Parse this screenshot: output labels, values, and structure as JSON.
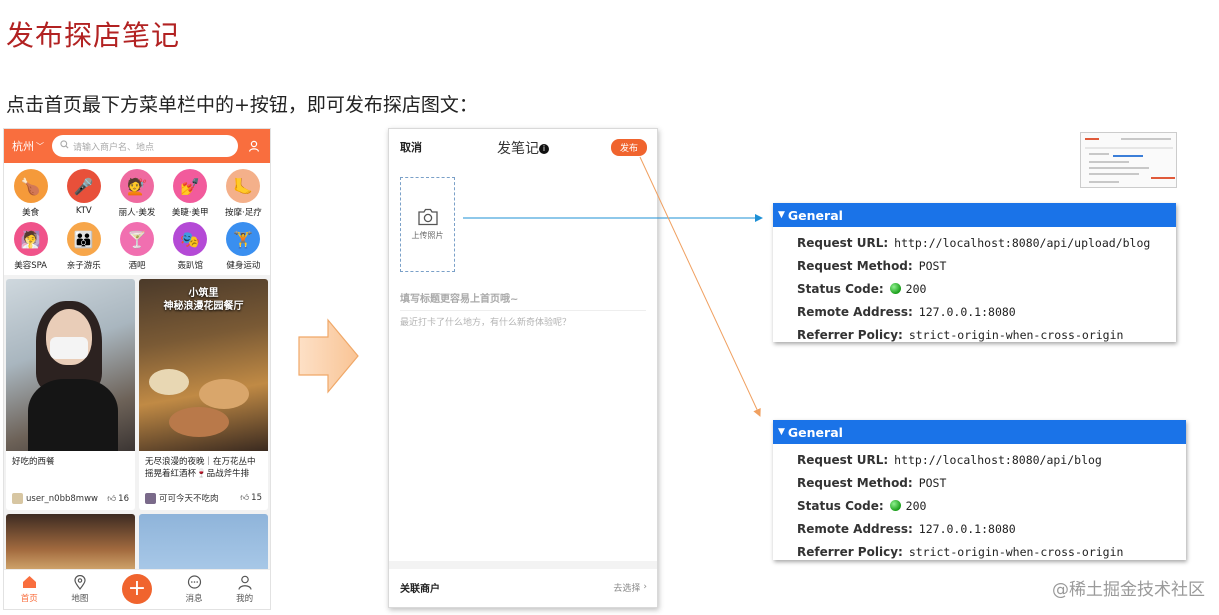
{
  "slide": {
    "title": "发布探店笔记",
    "subtitle": "点击首页最下方菜单栏中的+按钮，即可发布探店图文："
  },
  "phone1": {
    "city": "杭州",
    "search_placeholder": "请输入商户名、地点",
    "categories": [
      {
        "label": "美食",
        "icon": "roast-chicken-icon",
        "color": "#f59a3a",
        "glyph": "🍗"
      },
      {
        "label": "KTV",
        "icon": "microphone-icon",
        "color": "#e8503a",
        "glyph": "🎤"
      },
      {
        "label": "丽人·美发",
        "icon": "hair-icon",
        "color": "#ef6aa0",
        "glyph": "💇"
      },
      {
        "label": "美睫·美甲",
        "icon": "nail-icon",
        "color": "#f25b9c",
        "glyph": "💅"
      },
      {
        "label": "按摩·足疗",
        "icon": "foot-icon",
        "color": "#f4b08a",
        "glyph": "🦶"
      },
      {
        "label": "美容SPA",
        "icon": "face-mask-icon",
        "color": "#f0538a",
        "glyph": "🧖"
      },
      {
        "label": "亲子游乐",
        "icon": "family-icon",
        "color": "#f7a64a",
        "glyph": "👪"
      },
      {
        "label": "酒吧",
        "icon": "cocktail-icon",
        "color": "#f16fb0",
        "glyph": "🍸"
      },
      {
        "label": "轰趴馆",
        "icon": "party-mask-icon",
        "color": "#b44ad6",
        "glyph": "🎭"
      },
      {
        "label": "健身运动",
        "icon": "dumbbell-icon",
        "color": "#3a8ff0",
        "glyph": "🏋"
      }
    ],
    "cards": [
      {
        "title": "好吃的西餐",
        "user": "user_n0bb8mww",
        "likes": "16",
        "overlay": ""
      },
      {
        "title": "无尽浪漫的夜晚｜在万花丛中摇晃着红酒杯🍷品战斧牛排",
        "user": "可可今天不吃肉",
        "likes": "15",
        "overlay_line1": "小筑里",
        "overlay_line2": "神秘浪漫花园餐厅"
      }
    ],
    "tabs": [
      {
        "label": "首页",
        "icon": "home-icon",
        "glyph": "⌂"
      },
      {
        "label": "地图",
        "icon": "map-pin-icon",
        "glyph": "⌖"
      },
      {
        "label": "",
        "icon": "plus-icon",
        "glyph": "+"
      },
      {
        "label": "消息",
        "icon": "message-icon",
        "glyph": "💬"
      },
      {
        "label": "我的",
        "icon": "user-icon",
        "glyph": "👤"
      }
    ]
  },
  "phone2": {
    "cancel": "取消",
    "title": "发笔记",
    "publish": "发布",
    "upload_label": "上传照片",
    "title_placeholder": "填写标题更容易上首页哦~",
    "content_placeholder": "最近打卡了什么地方，有什么新奇体验呢？",
    "shop_label": "关联商户",
    "shop_select": "去选择"
  },
  "panel1": {
    "header": "General",
    "rows": [
      {
        "key": "Request URL:",
        "value": "http://localhost:8080/api/upload/blog"
      },
      {
        "key": "Request Method:",
        "value": "POST"
      },
      {
        "key": "Status Code:",
        "value": "200"
      },
      {
        "key": "Remote Address:",
        "value": "127.0.0.1:8080"
      },
      {
        "key": "Referrer Policy:",
        "value": "strict-origin-when-cross-origin"
      }
    ]
  },
  "panel2": {
    "header": "General",
    "rows": [
      {
        "key": "Request URL:",
        "value": "http://localhost:8080/api/blog"
      },
      {
        "key": "Request Method:",
        "value": "POST"
      },
      {
        "key": "Status Code:",
        "value": "200"
      },
      {
        "key": "Remote Address:",
        "value": "127.0.0.1:8080"
      },
      {
        "key": "Referrer Policy:",
        "value": "strict-origin-when-cross-origin"
      }
    ]
  },
  "watermark": "@稀土掘金技术社区",
  "colors": {
    "accent": "#f96e3e",
    "title_red": "#b22222",
    "devtools_blue": "#1a73e8",
    "status_green": "#1a9e1a",
    "connector_blue": "#1e90d6",
    "connector_orange": "#f0a060"
  }
}
